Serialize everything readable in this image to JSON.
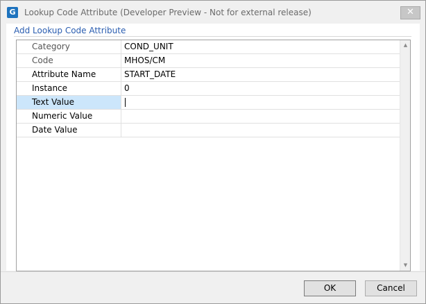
{
  "window": {
    "title": "Lookup Code Attribute (Developer Preview - Not for external release)",
    "app_icon_letter": "G",
    "close_glyph": "✕"
  },
  "header": {
    "link_text": "Add Lookup Code Attribute"
  },
  "grid": {
    "rows": [
      {
        "label": "Category",
        "value": "COND_UNIT"
      },
      {
        "label": "Code",
        "value": "MHOS/CM"
      },
      {
        "label": "Attribute Name",
        "value": "START_DATE"
      },
      {
        "label": "Instance",
        "value": "0"
      },
      {
        "label": "Text Value",
        "value": ""
      },
      {
        "label": "Numeric Value",
        "value": ""
      },
      {
        "label": "Date Value",
        "value": ""
      }
    ],
    "selected_row": "Text Value"
  },
  "scrollbar": {
    "up_glyph": "▲",
    "down_glyph": "▼"
  },
  "buttons": {
    "ok_label": "OK",
    "cancel_label": "Cancel"
  },
  "colors": {
    "accent_link": "#2a5db0",
    "selected_row": "#cce6fb"
  }
}
